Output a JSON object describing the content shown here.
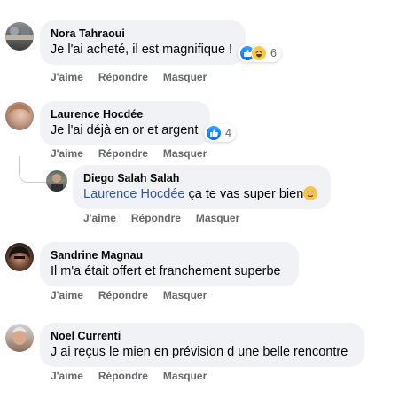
{
  "comments": [
    {
      "author": "Nora Tahraoui",
      "text": "Je l'ai acheté, il est magnifique !",
      "reaction_count": "6",
      "actions": [
        "J'aime",
        "Répondre",
        "Masquer"
      ]
    },
    {
      "author": "Laurence Hocdée",
      "text": "Je l'ai déjà en or et argent",
      "reaction_count": "4",
      "actions": [
        "J'aime",
        "Répondre",
        "Masquer"
      ],
      "reply": {
        "author": "Diego Salah Salah",
        "mention": "Laurence Hocdée",
        "text": " ça te vas super bien",
        "emoji": "smiling-face-icon",
        "actions": [
          "J'aime",
          "Répondre",
          "Masquer"
        ]
      }
    },
    {
      "author": "Sandrine Magnau",
      "text": "Il m'a était offert et franchement superbe",
      "actions": [
        "J'aime",
        "Répondre",
        "Masquer"
      ]
    },
    {
      "author": "Noel Currenti",
      "text": "J ai reçus le mien en prévision d une belle rencontre",
      "actions": [
        "J'aime",
        "Répondre",
        "Masquer"
      ]
    }
  ],
  "colors": {
    "bubble": "#f0f2f5",
    "action_text": "#65676b",
    "mention": "#385898",
    "like": "#0866ff"
  }
}
